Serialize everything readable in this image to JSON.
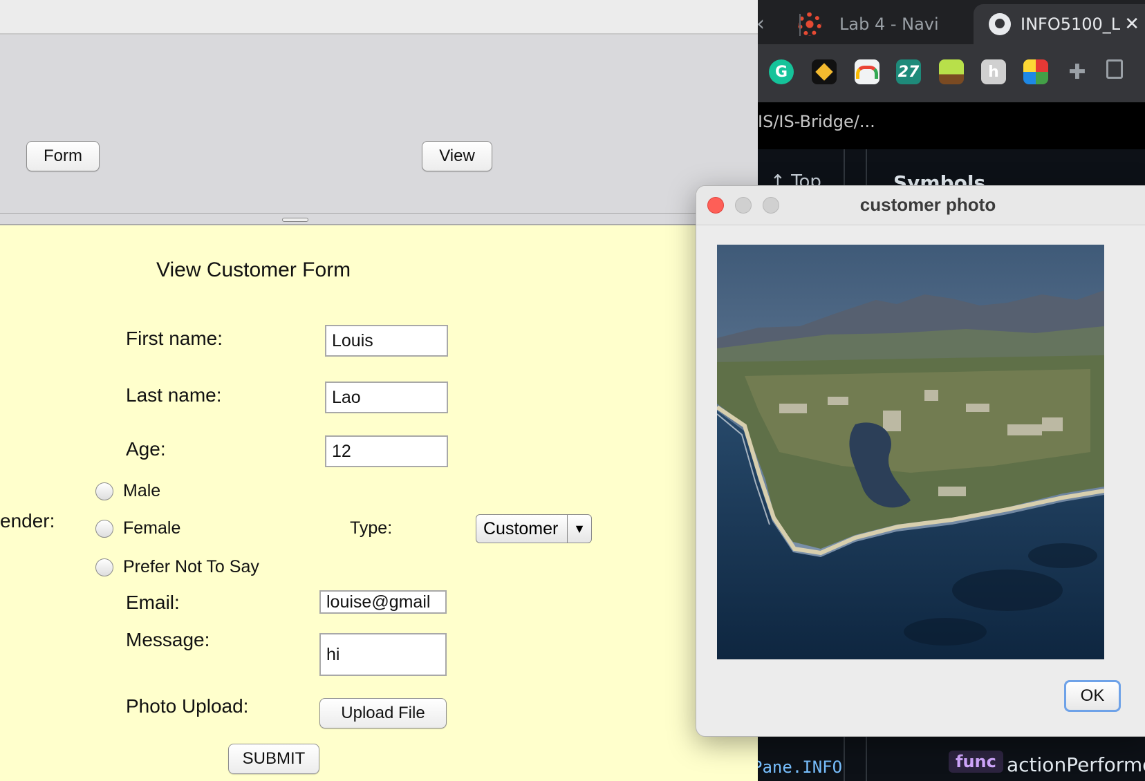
{
  "browser": {
    "tabs": [
      {
        "label": "Lab 4 - Navi",
        "icon": "canvas-icon"
      },
      {
        "label": "INFO5100_L",
        "icon": "github-icon"
      }
    ],
    "extensions": [
      "grammarly-icon",
      "binance-icon",
      "google-drive-icon",
      "number-27-icon",
      "forest-icon",
      "honey-icon",
      "unicode-pad-icon",
      "puzzle-extensions-icon",
      "sidebar-icon"
    ],
    "extension_27_label": "27",
    "extension_g_label": "G",
    "extension_h_label": "h",
    "breadcrumb": "IS/IS-Bridge/...",
    "code": {
      "top_link": "Top",
      "symbols_heading": "Symbols",
      "pane_text": "Pane.INFO",
      "func_badge": "func",
      "action_text": "actionPerforme"
    }
  },
  "app": {
    "buttons": {
      "form": "Form",
      "view": "View"
    },
    "form": {
      "title": "View Customer Form",
      "first_name_label": "First name:",
      "first_name_value": "Louis",
      "last_name_label": "Last name:",
      "last_name_value": "Lao",
      "age_label": "Age:",
      "age_value": "12",
      "gender_label": "ender:",
      "gender_options": [
        "Male",
        "Female",
        "Prefer Not To Say"
      ],
      "type_label": "Type:",
      "type_value": "Customer",
      "email_label": "Email:",
      "email_value": "louise@gmail",
      "message_label": "Message:",
      "message_value": "hi",
      "photo_label": "Photo Upload:",
      "upload_button": "Upload File",
      "submit_button": "SUBMIT"
    }
  },
  "dialog": {
    "title": "customer photo",
    "ok_button": "OK"
  },
  "colors": {
    "form_background": "#ffffcc",
    "panel_background": "#d9d9dc",
    "browser_dark": "#202124"
  }
}
